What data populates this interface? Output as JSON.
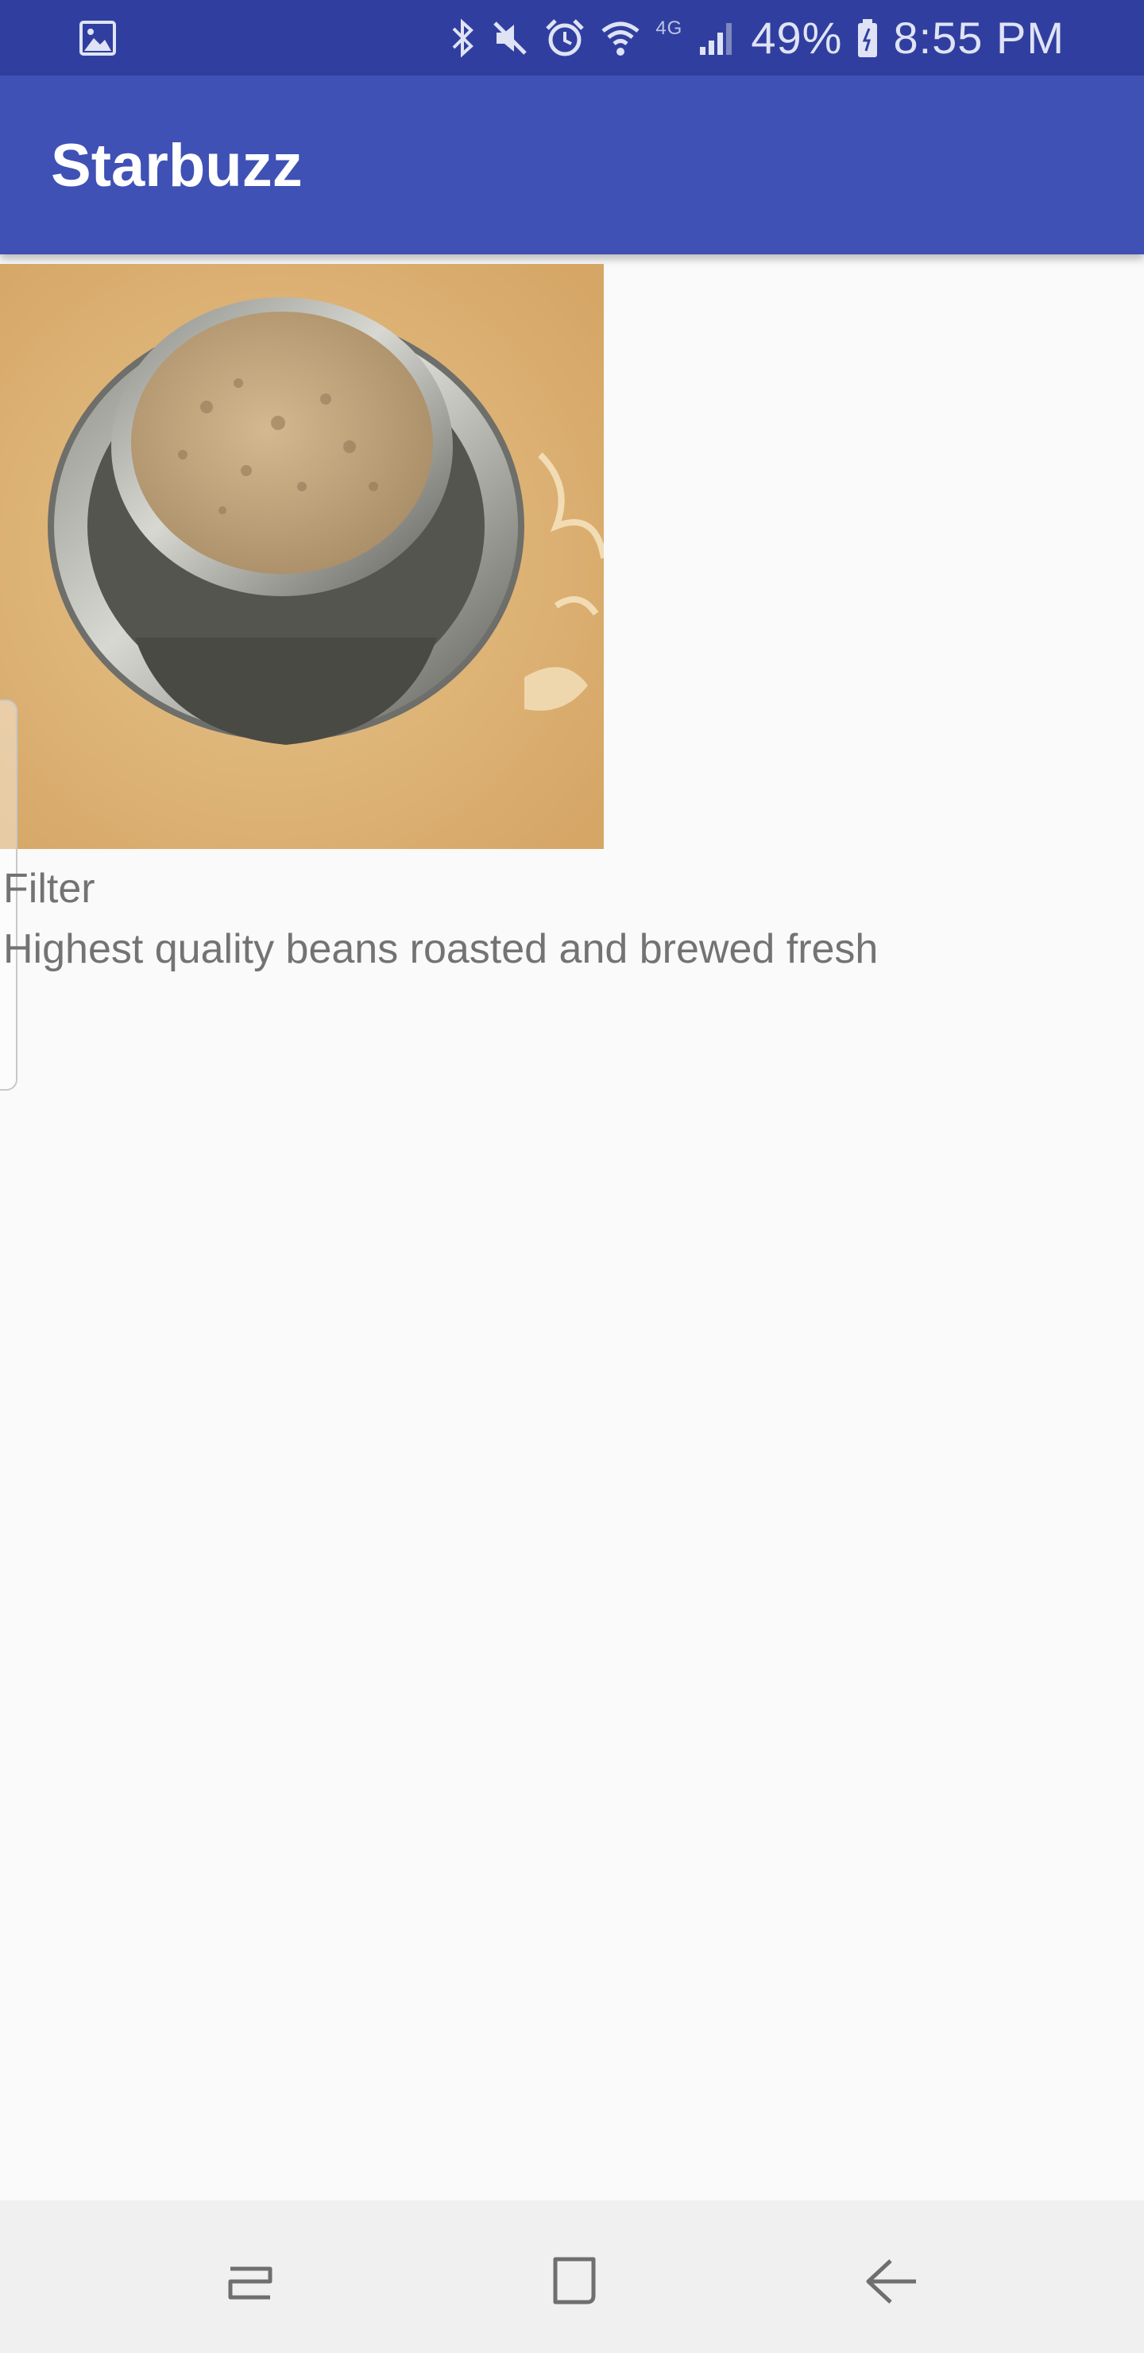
{
  "status_bar": {
    "battery": "49%",
    "time": "8:55 PM",
    "network": "4G",
    "icons": [
      "gallery-icon",
      "bluetooth-icon",
      "mute-icon",
      "alarm-icon",
      "wifi-icon",
      "signal-icon",
      "battery-icon"
    ]
  },
  "app_bar": {
    "title": "Starbuzz"
  },
  "drink": {
    "name": "Filter",
    "description": "Highest quality beans roasted and brewed fresh",
    "image_icon": "coffee-photo"
  },
  "nav_bar": {
    "icons": [
      "recent-apps-icon",
      "home-icon",
      "back-icon"
    ]
  },
  "colors": {
    "status_bar": "#303f9f",
    "app_bar": "#3f51b5",
    "background": "#fafafa",
    "text": "#737373",
    "nav_bar": "#f0f0f0"
  }
}
